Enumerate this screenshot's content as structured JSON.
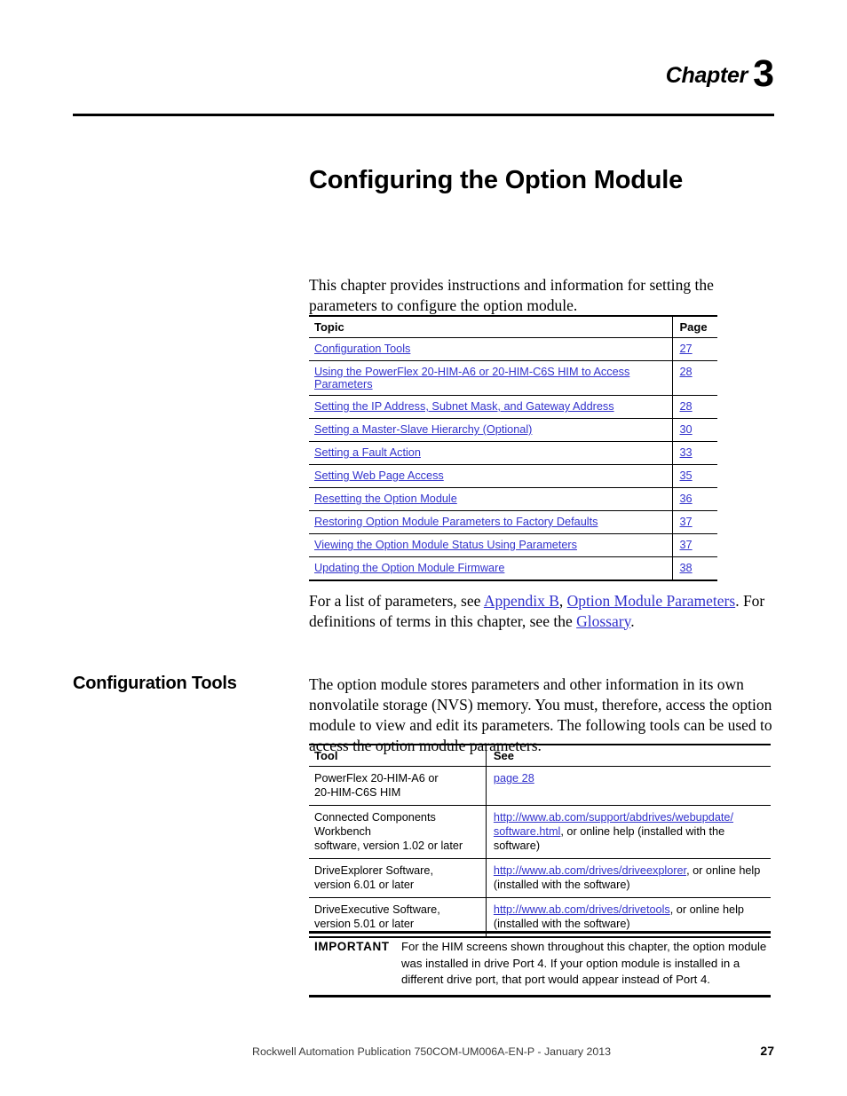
{
  "chapter": {
    "word": "Chapter",
    "number": "3",
    "title": "Configuring the Option Module"
  },
  "intro": {
    "paragraph": "This chapter provides instructions and information for setting the parameters to configure the option module."
  },
  "topic_table": {
    "headers": [
      "Topic",
      "Page"
    ],
    "rows": [
      {
        "topic": "Configuration Tools",
        "page": "27"
      },
      {
        "topic": "Using the PowerFlex 20-HIM-A6 or 20-HIM-C6S HIM to Access Parameters",
        "page": "28"
      },
      {
        "topic": "Setting the IP Address, Subnet Mask, and Gateway Address",
        "page": "28"
      },
      {
        "topic": "Setting a Master-Slave Hierarchy (Optional)",
        "page": "30"
      },
      {
        "topic": "Setting a Fault Action",
        "page": "33"
      },
      {
        "topic": "Setting Web Page Access",
        "page": "35"
      },
      {
        "topic": "Resetting the Option Module",
        "page": "36"
      },
      {
        "topic": "Restoring Option Module Parameters to Factory Defaults",
        "page": "37"
      },
      {
        "topic": "Viewing the Option Module Status Using Parameters",
        "page": "37"
      },
      {
        "topic": "Updating the Option Module Firmware",
        "page": "38"
      }
    ]
  },
  "params_paragraph": {
    "lead": "For a list of parameters, see ",
    "link_appendix": "Appendix B",
    "comma": ", ",
    "link_params": "Option Module Parameters",
    "middle": ". For definitions of terms in this chapter, see the ",
    "link_glossary": "Glossary",
    "end": "."
  },
  "section": {
    "heading": "Configuration Tools",
    "paragraph": "The option module stores parameters and other information in its own nonvolatile storage (NVS) memory. You must, therefore, access the option module to view and edit its parameters. The following tools can be used to access the option module parameters."
  },
  "tool_table": {
    "headers": [
      "Tool",
      "See"
    ],
    "rows": [
      {
        "tool_line1": "PowerFlex 20-HIM-A6 or",
        "tool_line2": "20-HIM-C6S HIM",
        "see_link": "page 28",
        "see_rest": "",
        "see_line2": ""
      },
      {
        "tool_line1": "Connected Components Workbench",
        "tool_line2": "software, version 1.02 or later",
        "see_link": "http://www.ab.com/support/abdrives/webupdate/",
        "see_link2": "software.html",
        "see_rest": ", or online help (installed with the software)",
        "see_line2": ""
      },
      {
        "tool_line1": "DriveExplorer Software,",
        "tool_line2": "version 6.01 or later",
        "see_link": "http://www.ab.com/drives/driveexplorer",
        "see_rest": ", or online help",
        "see_line2": "(installed with the software)"
      },
      {
        "tool_line1": "DriveExecutive Software,",
        "tool_line2": "version 5.01 or later",
        "see_link": "http://www.ab.com/drives/drivetools",
        "see_rest": ", or online help",
        "see_line2": "(installed with the software)"
      }
    ]
  },
  "important": {
    "label": "IMPORTANT",
    "text": "For the HIM screens shown throughout this chapter, the option module was installed in drive Port 4. If your option module is installed in a different drive port, that port would appear instead of Port 4."
  },
  "footer": {
    "publication": "Rockwell Automation Publication 750COM-UM006A-EN-P - January 2013",
    "page_number": "27"
  },
  "colors": {
    "link": "#3333cc",
    "text": "#000000",
    "footer_text": "#3a3a3a"
  }
}
